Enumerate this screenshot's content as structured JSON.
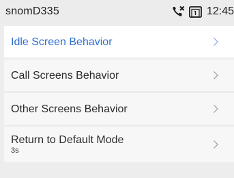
{
  "statusbar": {
    "device_name": "snomD335",
    "time": "12:45",
    "icons": [
      "missed-call-icon",
      "message-box-icon"
    ]
  },
  "menu": {
    "items": [
      {
        "label": "Idle Screen Behavior",
        "sub": "",
        "active": true
      },
      {
        "label": "Call Screens Behavior",
        "sub": "",
        "active": false
      },
      {
        "label": "Other Screens Behavior",
        "sub": "",
        "active": false
      },
      {
        "label": "Return to Default Mode",
        "sub": "3s",
        "active": false
      }
    ]
  },
  "colors": {
    "accent": "#2e6ecf",
    "background": "#ededed",
    "item_background": "#f7f7f7",
    "active_background": "#ffffff"
  }
}
